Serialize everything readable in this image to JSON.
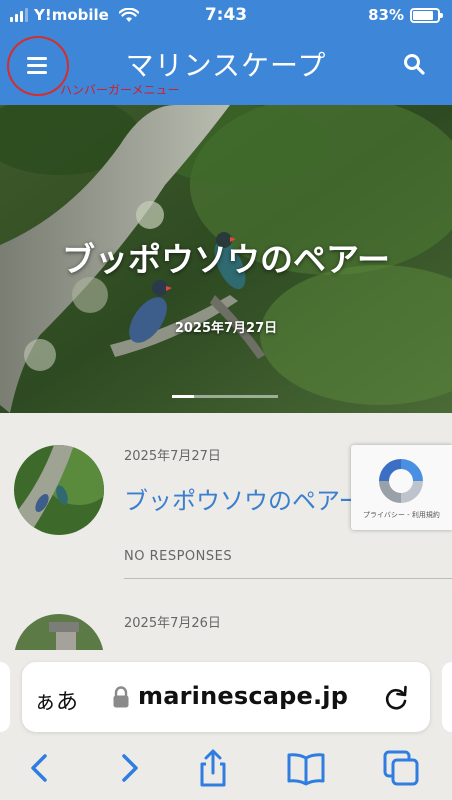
{
  "status": {
    "carrier": "Y!mobile",
    "time": "7:43",
    "battery": "83%",
    "battery_level": 0.83
  },
  "header": {
    "title": "マリンスケープ",
    "annotation": "ハンバーガーメニュー"
  },
  "hero": {
    "title": "ブッポウソウのペアー",
    "date": "2025年7月27日",
    "slide_count": 5,
    "active_slide": 1
  },
  "posts": [
    {
      "date": "2025年7月27日",
      "title": "ブッポウソウのペアー",
      "responses": "NO RESPONSES"
    },
    {
      "date": "2025年7月26日"
    }
  ],
  "recaptcha": {
    "text": "プライバシー - 利用規約"
  },
  "browser": {
    "aa": "ぁあ",
    "url": "marinescape.jp"
  },
  "colors": {
    "brand": "#3d86d8",
    "link": "#3b7fcf",
    "annotation": "#d62d2d"
  }
}
